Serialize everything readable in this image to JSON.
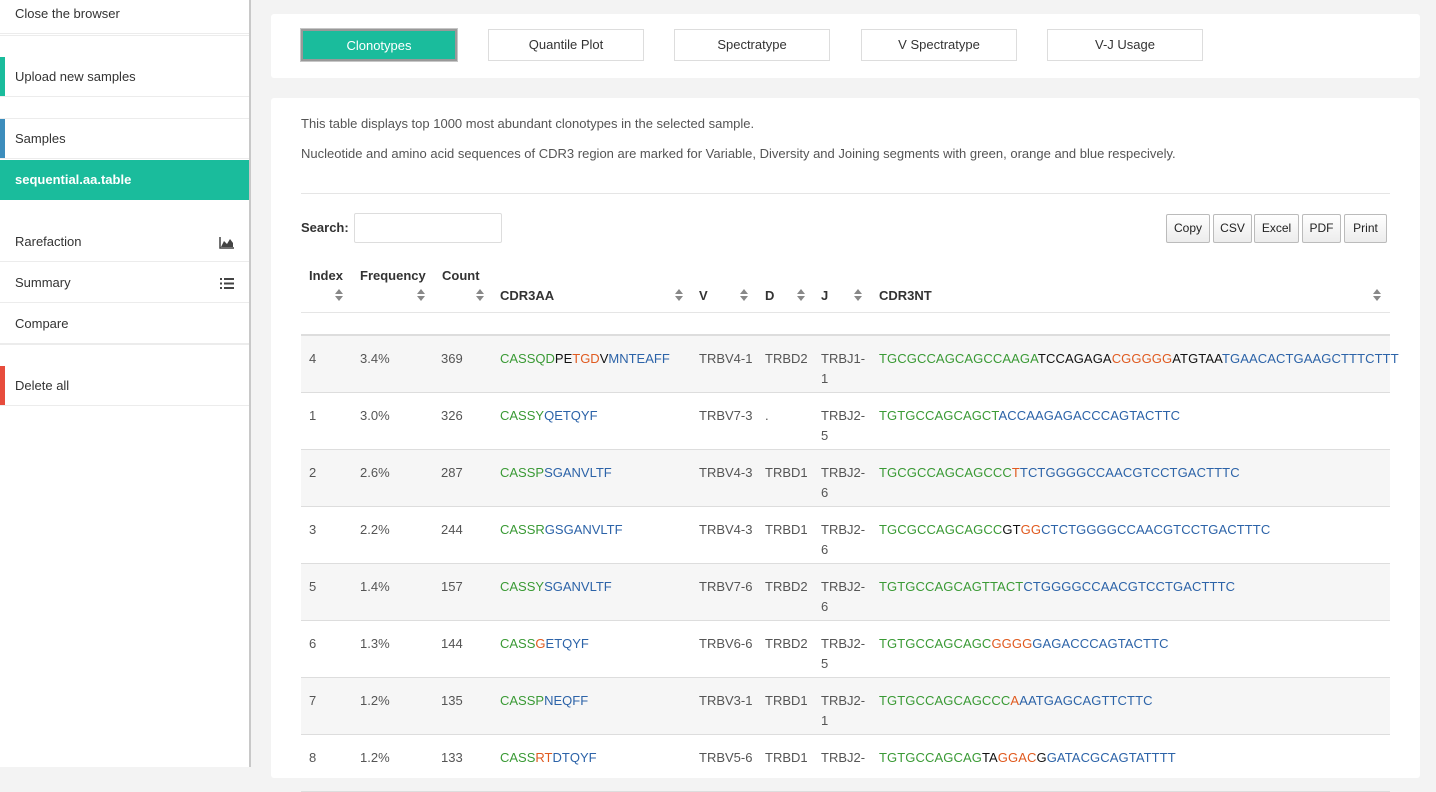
{
  "sidebar": {
    "items": [
      {
        "label": "Close the browser"
      },
      {
        "label": "Upload new samples",
        "bar_color": "#1abc9c"
      },
      {
        "label": "Samples",
        "bar_color": "#3c8dbc"
      },
      {
        "label": "sequential.aa.table",
        "active": true
      },
      {
        "label": "Rarefaction",
        "icon": "area-chart-icon"
      },
      {
        "label": "Summary",
        "icon": "list-icon"
      },
      {
        "label": "Compare"
      },
      {
        "label": "Delete all",
        "bar_color": "#e74c3c"
      }
    ]
  },
  "tabs": [
    {
      "label": "Clonotypes",
      "active": true
    },
    {
      "label": "Quantile Plot"
    },
    {
      "label": "Spectratype"
    },
    {
      "label": "V Spectratype"
    },
    {
      "label": "V-J Usage"
    }
  ],
  "description": {
    "line1": "This table displays top 1000 most abundant clonotypes in the selected sample.",
    "line2": "Nucleotide and amino acid sequences of CDR3 region are marked for Variable, Diversity and Joining segments with green, orange and blue respecively."
  },
  "search": {
    "label": "Search:",
    "value": ""
  },
  "export_buttons": [
    "Copy",
    "CSV",
    "Excel",
    "PDF",
    "Print"
  ],
  "table": {
    "columns": [
      "Index",
      "Frequency",
      "Count",
      "CDR3AA",
      "V",
      "D",
      "J",
      "CDR3NT"
    ],
    "rows": [
      {
        "index": "4",
        "frequency": "3.4%",
        "count": "369",
        "cdr3aa": [
          [
            "g",
            "CASSQD"
          ],
          [
            "k",
            "PE"
          ],
          [
            "o",
            "TGD"
          ],
          [
            "k",
            "V"
          ],
          [
            "b",
            "MNTEAFF"
          ]
        ],
        "v": "TRBV4-1",
        "d": "TRBD2",
        "j1": "TRBJ1-",
        "j2": "1",
        "cdr3nt": [
          [
            "g",
            "TGCGCCAGCAGCCAAGA"
          ],
          [
            "k",
            "TCCAGAGA"
          ],
          [
            "o",
            "CGGGGG"
          ],
          [
            "k",
            "ATGTAA"
          ],
          [
            "b",
            "TGAACACTGAAGCTTTCTTT"
          ]
        ]
      },
      {
        "index": "1",
        "frequency": "3.0%",
        "count": "326",
        "cdr3aa": [
          [
            "g",
            "CASSY"
          ],
          [
            "b",
            "QETQYF"
          ]
        ],
        "v": "TRBV7-3",
        "d": ".",
        "j1": "TRBJ2-",
        "j2": "5",
        "cdr3nt": [
          [
            "g",
            "TGTGCCAGCAGCT"
          ],
          [
            "b",
            "ACCAAGAGACCCAGTACTTC"
          ]
        ]
      },
      {
        "index": "2",
        "frequency": "2.6%",
        "count": "287",
        "cdr3aa": [
          [
            "g",
            "CASSP"
          ],
          [
            "b",
            "SGANVLTF"
          ]
        ],
        "v": "TRBV4-3",
        "d": "TRBD1",
        "j1": "TRBJ2-",
        "j2": "6",
        "cdr3nt": [
          [
            "g",
            "TGCGCCAGCAGCCC"
          ],
          [
            "o",
            "T"
          ],
          [
            "b",
            "TCTGGGGCCAACGTCCTGACTTTC"
          ]
        ]
      },
      {
        "index": "3",
        "frequency": "2.2%",
        "count": "244",
        "cdr3aa": [
          [
            "g",
            "CASSR"
          ],
          [
            "b",
            "GSGANVLTF"
          ]
        ],
        "v": "TRBV4-3",
        "d": "TRBD1",
        "j1": "TRBJ2-",
        "j2": "6",
        "cdr3nt": [
          [
            "g",
            "TGCGCCAGCAGCC"
          ],
          [
            "k",
            "GT"
          ],
          [
            "o",
            "GG"
          ],
          [
            "b",
            "CTCTGGGGCCAACGTCCTGACTTTC"
          ]
        ]
      },
      {
        "index": "5",
        "frequency": "1.4%",
        "count": "157",
        "cdr3aa": [
          [
            "g",
            "CASSY"
          ],
          [
            "b",
            "SGANVLTF"
          ]
        ],
        "v": "TRBV7-6",
        "d": "TRBD2",
        "j1": "TRBJ2-",
        "j2": "6",
        "cdr3nt": [
          [
            "g",
            "TGTGCCAGCAGTTACT"
          ],
          [
            "b",
            "CTGGGGCCAACGTCCTGACTTTC"
          ]
        ]
      },
      {
        "index": "6",
        "frequency": "1.3%",
        "count": "144",
        "cdr3aa": [
          [
            "g",
            "CASS"
          ],
          [
            "o",
            "G"
          ],
          [
            "b",
            "ETQYF"
          ]
        ],
        "v": "TRBV6-6",
        "d": "TRBD2",
        "j1": "TRBJ2-",
        "j2": "5",
        "cdr3nt": [
          [
            "g",
            "TGTGCCAGCAGC"
          ],
          [
            "o",
            "GGGG"
          ],
          [
            "b",
            "GAGACCCAGTACTTC"
          ]
        ]
      },
      {
        "index": "7",
        "frequency": "1.2%",
        "count": "135",
        "cdr3aa": [
          [
            "g",
            "CASSP"
          ],
          [
            "b",
            "NEQFF"
          ]
        ],
        "v": "TRBV3-1",
        "d": "TRBD1",
        "j1": "TRBJ2-",
        "j2": "1",
        "cdr3nt": [
          [
            "g",
            "TGTGCCAGCAGCCC"
          ],
          [
            "o",
            "A"
          ],
          [
            "b",
            "AATGAGCAGTTCTTC"
          ]
        ]
      },
      {
        "index": "8",
        "frequency": "1.2%",
        "count": "133",
        "cdr3aa": [
          [
            "g",
            "CASS"
          ],
          [
            "o",
            "RT"
          ],
          [
            "b",
            "DTQYF"
          ]
        ],
        "v": "TRBV5-6",
        "d": "TRBD1",
        "j1": "TRBJ2-",
        "j2": "",
        "cdr3nt": [
          [
            "g",
            "TGTGCCAGCAG"
          ],
          [
            "k",
            "TA"
          ],
          [
            "o",
            "GGAC"
          ],
          [
            "k",
            "G"
          ],
          [
            "b",
            "GATACGCAGTATTTT"
          ]
        ]
      }
    ]
  }
}
